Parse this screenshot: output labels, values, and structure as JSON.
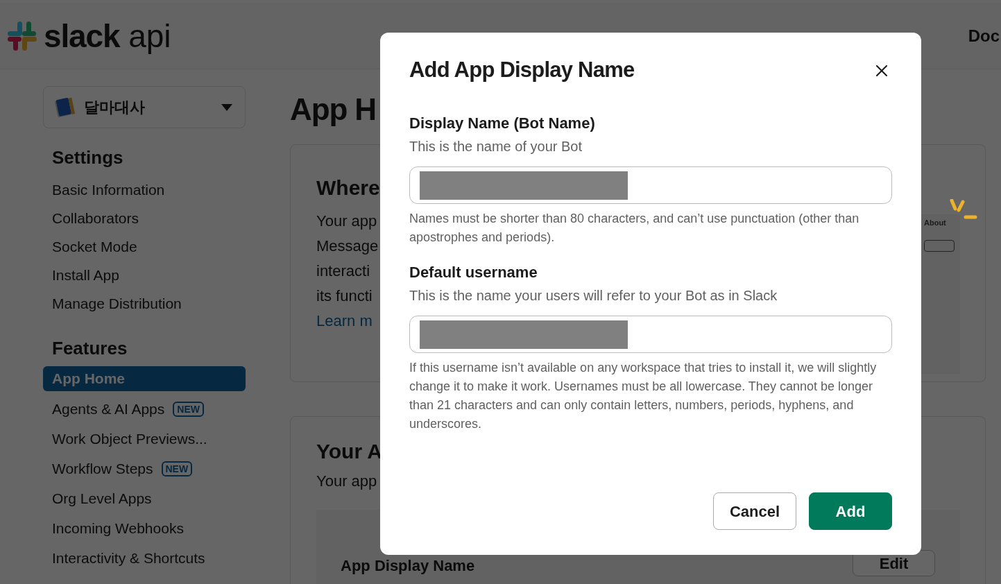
{
  "header": {
    "logo_bold": "slack",
    "logo_light": "api",
    "nav_link": "Doc"
  },
  "sidebar": {
    "app_selector": "달마대사",
    "sections": [
      {
        "title": "Settings",
        "items": [
          {
            "label": "Basic Information",
            "selected": false
          },
          {
            "label": "Collaborators",
            "selected": false
          },
          {
            "label": "Socket Mode",
            "selected": false
          },
          {
            "label": "Install App",
            "selected": false
          },
          {
            "label": "Manage Distribution",
            "selected": false
          }
        ]
      },
      {
        "title": "Features",
        "items": [
          {
            "label": "App Home",
            "selected": true
          },
          {
            "label": "Agents & AI Apps",
            "selected": false,
            "badge": "NEW"
          },
          {
            "label": "Work Object Previews...",
            "selected": false
          },
          {
            "label": "Workflow Steps",
            "selected": false,
            "badge": "NEW"
          },
          {
            "label": "Org Level Apps",
            "selected": false
          },
          {
            "label": "Incoming Webhooks",
            "selected": false
          },
          {
            "label": "Interactivity & Shortcuts",
            "selected": false
          }
        ]
      }
    ]
  },
  "main": {
    "title": "App H",
    "intro_card": {
      "heading": "Where",
      "lines": [
        "Your app",
        "Message",
        "interacti",
        "its functi"
      ],
      "link": "Learn m",
      "preview_tab": "About"
    },
    "display_card": {
      "heading": "Your A",
      "text": "Your app",
      "row_label": "App Display Name",
      "row_button": "Edit"
    }
  },
  "dialog": {
    "title": "Add App Display Name",
    "fields": [
      {
        "label": "Display Name (Bot Name)",
        "description": "This is the name of your Bot",
        "redacted": true,
        "help": "Names must be shorter than 80 characters, and can’t use punctuation (other than apostrophes and periods)."
      },
      {
        "label": "Default username",
        "description": "This is the name your users will refer to your Bot as in Slack",
        "redacted": true,
        "help": "If this username isn’t available on any workspace that tries to install it, we will slightly change it to make it work. Usernames must be all lowercase. They cannot be longer than 21 characters and can only contain letters, numbers, periods, hyphens, and underscores."
      }
    ],
    "buttons": [
      {
        "label": "Cancel",
        "kind": "secondary"
      },
      {
        "label": "Add",
        "kind": "primary"
      }
    ]
  }
}
